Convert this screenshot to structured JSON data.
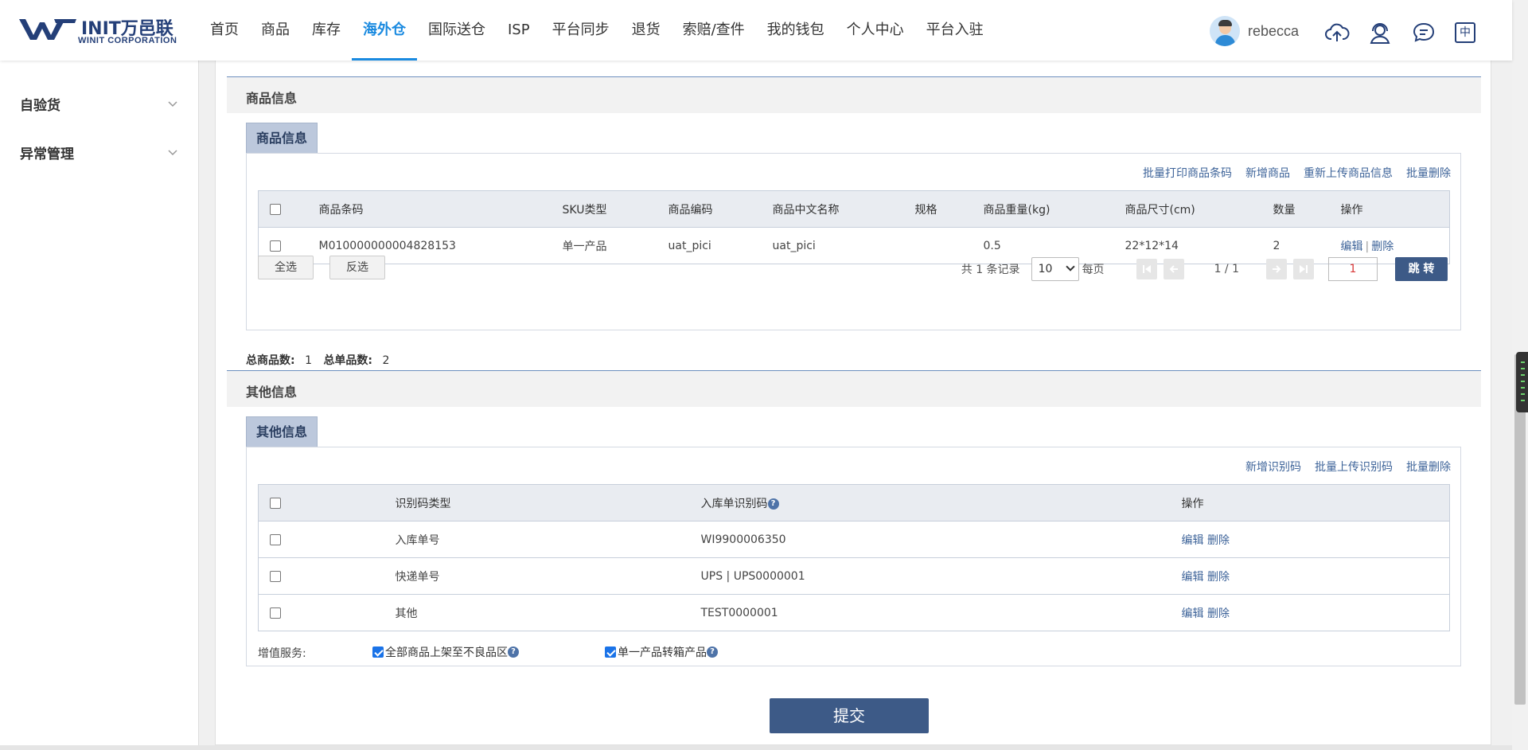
{
  "header": {
    "brand": "INIT万邑联",
    "brand_sub": "WINIT CORPORATION",
    "nav": [
      "首页",
      "商品",
      "库存",
      "海外仓",
      "国际送仓",
      "ISP",
      "平台同步",
      "退货",
      "索赔/查件",
      "我的钱包",
      "个人中心",
      "平台入驻"
    ],
    "active_nav": "海外仓",
    "username": "rebecca",
    "lang_label": "中",
    "accent_color": "#1a8ae0"
  },
  "sidebar": {
    "items": [
      {
        "label": "自验货"
      },
      {
        "label": "异常管理"
      }
    ]
  },
  "product_section": {
    "title": "商品信息",
    "tab": "商品信息",
    "actions": [
      "批量打印商品条码",
      "新增商品",
      "重新上传商品信息",
      "批量删除"
    ],
    "columns": [
      "商品条码",
      "SKU类型",
      "商品编码",
      "商品中文名称",
      "规格",
      "商品重量(kg)",
      "商品尺寸(cm)",
      "数量",
      "操作"
    ],
    "rows": [
      {
        "barcode": "M010000000004828153",
        "sku_type": "单一产品",
        "code": "uat_pici",
        "name_cn": "uat_pici",
        "spec": "",
        "weight": "0.5",
        "size": "22*12*14",
        "qty": "2",
        "edit": "编辑",
        "sep": "|",
        "delete": "删除"
      }
    ],
    "select_all": "全选",
    "invert": "反选",
    "pager": {
      "total_text": "共 1 条记录",
      "page_size": "10",
      "per_page": "每页",
      "page_info": "1 / 1",
      "page_input": "1",
      "jump": "跳 转"
    },
    "totals": {
      "label_total_goods": "总商品数:",
      "total_goods": "1",
      "label_total_qty": "总单品数:",
      "total_qty": "2"
    }
  },
  "other_section": {
    "title": "其他信息",
    "tab": "其他信息",
    "actions": [
      "新增识别码",
      "批量上传识别码",
      "批量删除"
    ],
    "columns": [
      "识别码类型",
      "入库单识别码",
      "操作"
    ],
    "help_mark": "?",
    "rows": [
      {
        "type": "入库单号",
        "code": "WI9900006350",
        "edit": "编辑",
        "delete": "删除"
      },
      {
        "type": "快递单号",
        "code": "UPS | UPS0000001",
        "edit": "编辑",
        "delete": "删除"
      },
      {
        "type": "其他",
        "code": "TEST0000001",
        "edit": "编辑",
        "delete": "删除"
      }
    ],
    "value_added_label": "增值服务:",
    "options": [
      {
        "label": "全部商品上架至不良品区",
        "checked": true
      },
      {
        "label": "单一产品转箱产品",
        "checked": true
      }
    ]
  },
  "submit_label": "提交"
}
